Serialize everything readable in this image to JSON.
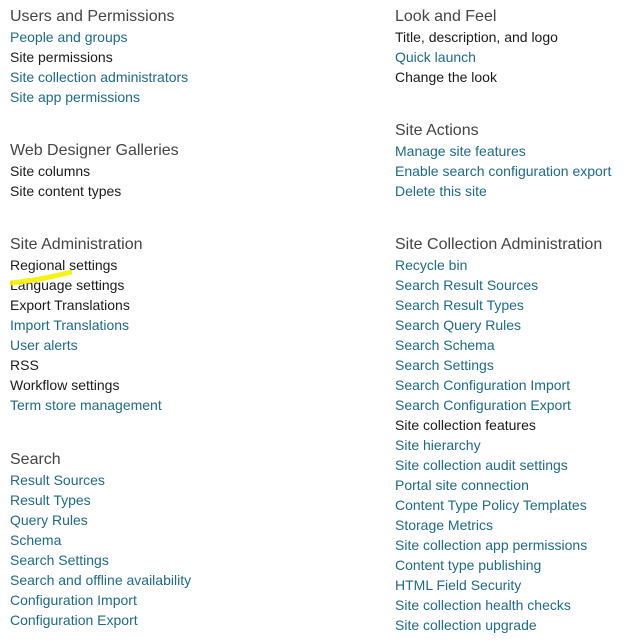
{
  "left_sections": [
    {
      "heading": "Users and Permissions",
      "links": [
        {
          "label": "People and groups",
          "style": "blue"
        },
        {
          "label": "Site permissions",
          "style": "dark"
        },
        {
          "label": "Site collection administrators",
          "style": "blue"
        },
        {
          "label": "Site app permissions",
          "style": "blue"
        }
      ]
    },
    {
      "heading": "Web Designer Galleries",
      "links": [
        {
          "label": "Site columns",
          "style": "dark"
        },
        {
          "label": "Site content types",
          "style": "dark"
        }
      ]
    },
    {
      "heading": "Site Administration",
      "links": [
        {
          "label": "Regional settings",
          "style": "dark"
        },
        {
          "label": "Language settings",
          "style": "dark"
        },
        {
          "label": "Export Translations",
          "style": "dark"
        },
        {
          "label": "Import Translations",
          "style": "blue"
        },
        {
          "label": "User alerts",
          "style": "blue"
        },
        {
          "label": "RSS",
          "style": "dark"
        },
        {
          "label": "Workflow settings",
          "style": "dark"
        },
        {
          "label": "Term store management",
          "style": "blue"
        }
      ]
    },
    {
      "heading": "Search",
      "links": [
        {
          "label": "Result Sources",
          "style": "blue"
        },
        {
          "label": "Result Types",
          "style": "blue"
        },
        {
          "label": "Query Rules",
          "style": "blue"
        },
        {
          "label": "Schema",
          "style": "blue"
        },
        {
          "label": "Search Settings",
          "style": "blue"
        },
        {
          "label": "Search and offline availability",
          "style": "blue"
        },
        {
          "label": "Configuration Import",
          "style": "blue"
        },
        {
          "label": "Configuration Export",
          "style": "blue"
        }
      ]
    }
  ],
  "right_sections": [
    {
      "heading": "Look and Feel",
      "links": [
        {
          "label": "Title, description, and logo",
          "style": "dark"
        },
        {
          "label": "Quick launch",
          "style": "blue"
        },
        {
          "label": "Change the look",
          "style": "dark"
        }
      ]
    },
    {
      "heading": "Site Actions",
      "links": [
        {
          "label": "Manage site features",
          "style": "blue"
        },
        {
          "label": "Enable search configuration export",
          "style": "blue"
        },
        {
          "label": "Delete this site",
          "style": "blue"
        }
      ]
    },
    {
      "heading": "Site Collection Administration",
      "links": [
        {
          "label": "Recycle bin",
          "style": "blue"
        },
        {
          "label": "Search Result Sources",
          "style": "blue"
        },
        {
          "label": "Search Result Types",
          "style": "blue"
        },
        {
          "label": "Search Query Rules",
          "style": "blue"
        },
        {
          "label": "Search Schema",
          "style": "blue"
        },
        {
          "label": "Search Settings",
          "style": "blue"
        },
        {
          "label": "Search Configuration Import",
          "style": "blue"
        },
        {
          "label": "Search Configuration Export",
          "style": "blue"
        },
        {
          "label": "Site collection features",
          "style": "dark"
        },
        {
          "label": "Site hierarchy",
          "style": "blue"
        },
        {
          "label": "Site collection audit settings",
          "style": "blue"
        },
        {
          "label": "Portal site connection",
          "style": "blue"
        },
        {
          "label": "Content Type Policy Templates",
          "style": "blue"
        },
        {
          "label": "Storage Metrics",
          "style": "blue"
        },
        {
          "label": "Site collection app permissions",
          "style": "blue"
        },
        {
          "label": "Content type publishing",
          "style": "blue"
        },
        {
          "label": "HTML Field Security",
          "style": "blue"
        },
        {
          "label": "Site collection health checks",
          "style": "blue"
        },
        {
          "label": "Site collection upgrade",
          "style": "blue"
        }
      ]
    }
  ],
  "colors": {
    "link_blue": "#1e6a87",
    "link_dark": "#1a1a1a",
    "heading": "#444444",
    "highlighter": "#f5f000"
  }
}
